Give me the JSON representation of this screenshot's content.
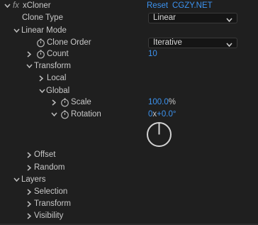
{
  "effect": {
    "fx_label": "fx",
    "name": "xCloner",
    "reset": "Reset",
    "preset": "CGZY.NET"
  },
  "clone_type": {
    "label": "Clone Type",
    "value": "Linear"
  },
  "linear_mode": {
    "label": "Linear Mode",
    "clone_order": {
      "label": "Clone Order",
      "value": "Iterative"
    },
    "count": {
      "label": "Count",
      "value": "10"
    },
    "transform": {
      "label": "Transform",
      "local": "Local",
      "global": {
        "label": "Global",
        "scale": {
          "label": "Scale",
          "value": "100.0",
          "unit": "%"
        },
        "rotation": {
          "label": "Rotation",
          "turns": "0",
          "x": "x",
          "degrees": "+0.0°",
          "dial_angle_deg": 0
        }
      }
    },
    "offset": "Offset",
    "random": "Random"
  },
  "layers": {
    "label": "Layers",
    "selection": "Selection",
    "transform": "Transform",
    "visibility": "Visibility"
  },
  "colors": {
    "accent": "#3c93f0",
    "bg": "#1f1f1f",
    "text": "#c8c8c8"
  }
}
